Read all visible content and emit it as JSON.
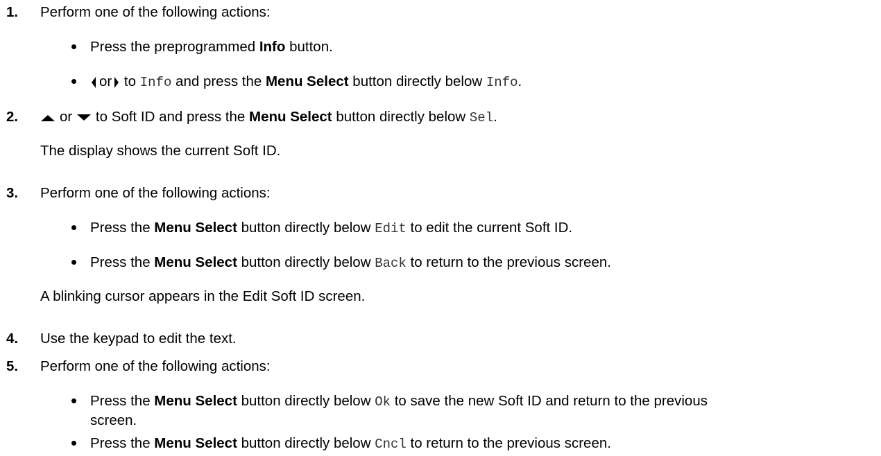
{
  "steps": [
    {
      "number": "1.",
      "text": "Perform one of the following actions:",
      "bullets": [
        {
          "pre": "Press the preprogrammed ",
          "bold": "Info",
          "post": " button."
        },
        {
          "or": "or",
          "to": " to ",
          "code1": "Info",
          "mid": " and press the ",
          "bold": "Menu Select",
          "post": " button directly below ",
          "code2": "Info",
          "end": "."
        }
      ]
    },
    {
      "number": "2.",
      "or": "or",
      "text_pre": " to Soft ID and press the ",
      "bold": "Menu Select",
      "text_post": " button directly below ",
      "code": "Sel",
      "end": ".",
      "result": "The display shows the current Soft ID."
    },
    {
      "number": "3.",
      "text": "Perform one of the following actions:",
      "bullets": [
        {
          "pre": "Press the ",
          "bold": "Menu Select",
          "mid": " button directly below ",
          "code": "Edit",
          "post": " to edit the current Soft ID."
        },
        {
          "pre": "Press the ",
          "bold": "Menu Select",
          "mid": " button directly below ",
          "code": "Back",
          "post": " to return to the previous screen."
        }
      ],
      "result": "A blinking cursor appears in the Edit Soft ID screen."
    },
    {
      "number": "4.",
      "text": "Use the keypad to edit the text."
    },
    {
      "number": "5.",
      "text": "Perform one of the following actions:",
      "bullets": [
        {
          "pre": "Press the ",
          "bold": "Menu Select",
          "mid": " button directly below ",
          "code": "Ok",
          "post": " to save the new Soft ID and return to the previous",
          "cont": "screen."
        },
        {
          "pre": "Press the ",
          "bold": "Menu Select",
          "mid": " button directly below ",
          "code": "Cncl",
          "post": " to return to the previous screen."
        }
      ]
    }
  ],
  "icons": {
    "left": "left-arrow-icon",
    "right": "right-arrow-icon",
    "up": "up-arrow-icon",
    "down": "down-arrow-icon"
  }
}
